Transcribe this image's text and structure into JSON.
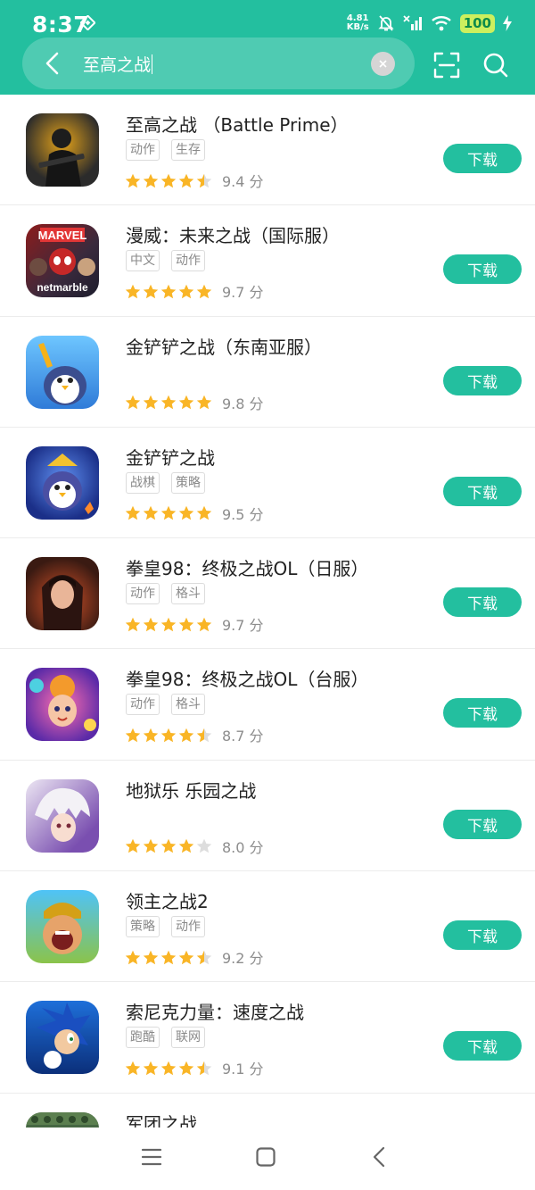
{
  "status_bar": {
    "time": "8:37",
    "net_speed_value": "4.81",
    "net_speed_unit": "KB/s",
    "battery": "100"
  },
  "search": {
    "query": "至高之战",
    "icons": {
      "back": "back-arrow-icon",
      "clear": "clear-icon",
      "scan": "scan-icon",
      "search": "search-icon"
    }
  },
  "download_label": "下载",
  "apps": [
    {
      "name": "至高之战 （Battle Prime）",
      "tags": [
        "动作",
        "生存"
      ],
      "stars": 4.5,
      "score": "9.4 分"
    },
    {
      "name": "漫威：未来之战（国际服）",
      "tags": [
        "中文",
        "动作"
      ],
      "stars": 5,
      "score": "9.7 分"
    },
    {
      "name": "金铲铲之战（东南亚服）",
      "tags": [],
      "stars": 5,
      "score": "9.8 分"
    },
    {
      "name": "金铲铲之战",
      "tags": [
        "战棋",
        "策略"
      ],
      "stars": 5,
      "score": "9.5 分"
    },
    {
      "name": "拳皇98：终极之战OL（日服）",
      "tags": [
        "动作",
        "格斗"
      ],
      "stars": 5,
      "score": "9.7 分"
    },
    {
      "name": "拳皇98：终极之战OL（台服）",
      "tags": [
        "动作",
        "格斗"
      ],
      "stars": 4.5,
      "score": "8.7 分"
    },
    {
      "name": "地狱乐 乐园之战",
      "tags": [],
      "stars": 4,
      "score": "8.0 分"
    },
    {
      "name": "领主之战2",
      "tags": [
        "策略",
        "动作"
      ],
      "stars": 4.5,
      "score": "9.2 分"
    },
    {
      "name": "索尼克力量：速度之战",
      "tags": [
        "跑酷",
        "联网"
      ],
      "stars": 4.5,
      "score": "9.1 分"
    },
    {
      "name": "军团之战",
      "tags": [],
      "stars": null,
      "score": ""
    }
  ],
  "colors": {
    "accent": "#23bf9f",
    "star_filled": "#f9b526",
    "star_empty": "#dddddd",
    "tag_text": "#8a8a8a"
  },
  "nav_bar": {
    "items": [
      "menu-icon",
      "home-icon",
      "back-icon"
    ]
  }
}
